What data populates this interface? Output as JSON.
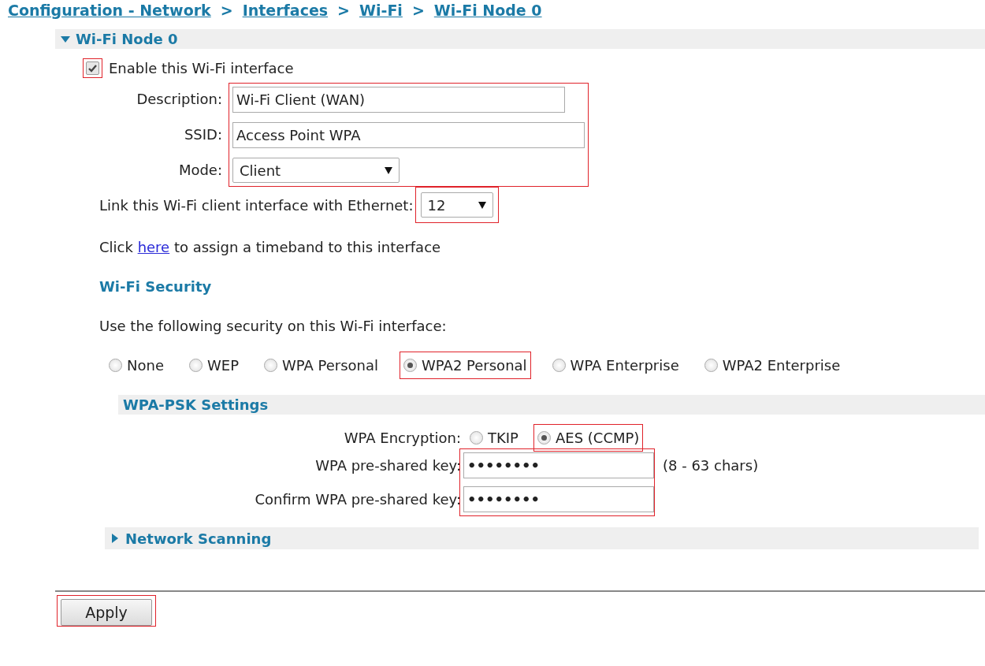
{
  "breadcrumb": {
    "separator": ">",
    "items": [
      {
        "label": "Configuration - Network"
      },
      {
        "label": "Interfaces"
      },
      {
        "label": "Wi-Fi"
      },
      {
        "label": "Wi-Fi Node 0"
      }
    ]
  },
  "node": {
    "title": "Wi-Fi Node 0",
    "expanded": true
  },
  "enable": {
    "label": "Enable this Wi-Fi interface",
    "checked": true,
    "highlighted": true
  },
  "fields_highlighted": true,
  "fields": [
    {
      "label": "Description:",
      "value": "Wi-Fi Client (WAN)",
      "kind": "text"
    },
    {
      "label": "SSID:",
      "value": "Access Point WPA",
      "kind": "text"
    },
    {
      "label": "Mode:",
      "value": "Client",
      "kind": "select"
    }
  ],
  "ethernet_link": {
    "label": "Link this Wi-Fi client interface with Ethernet:",
    "value": "12",
    "highlighted": true
  },
  "timeband": {
    "before": "Click",
    "link": "here",
    "after": "to assign a timeband to this interface"
  },
  "security": {
    "title": "Wi-Fi Security",
    "prompt": "Use the following security on this Wi-Fi interface:",
    "options": [
      {
        "label": "None",
        "selected": false,
        "highlighted": false
      },
      {
        "label": "WEP",
        "selected": false,
        "highlighted": false
      },
      {
        "label": "WPA Personal",
        "selected": false,
        "highlighted": false
      },
      {
        "label": "WPA2 Personal",
        "selected": true,
        "highlighted": true
      },
      {
        "label": "WPA Enterprise",
        "selected": false,
        "highlighted": false
      },
      {
        "label": "WPA2 Enterprise",
        "selected": false,
        "highlighted": false
      }
    ]
  },
  "psk": {
    "title": "WPA-PSK Settings",
    "encryption_label": "WPA Encryption:",
    "encryption": [
      {
        "label": "TKIP",
        "selected": false,
        "highlighted": false
      },
      {
        "label": "AES (CCMP)",
        "selected": true,
        "highlighted": true
      }
    ],
    "keys_highlighted": true,
    "keys": [
      {
        "label": "WPA pre-shared key:",
        "value": "••••••••",
        "hint": "(8 - 63 chars)"
      },
      {
        "label": "Confirm WPA pre-shared key:",
        "value": "••••••••"
      }
    ]
  },
  "network_scanning": {
    "title": "Network Scanning",
    "expanded": false
  },
  "apply": {
    "label": "Apply",
    "highlighted": true
  }
}
